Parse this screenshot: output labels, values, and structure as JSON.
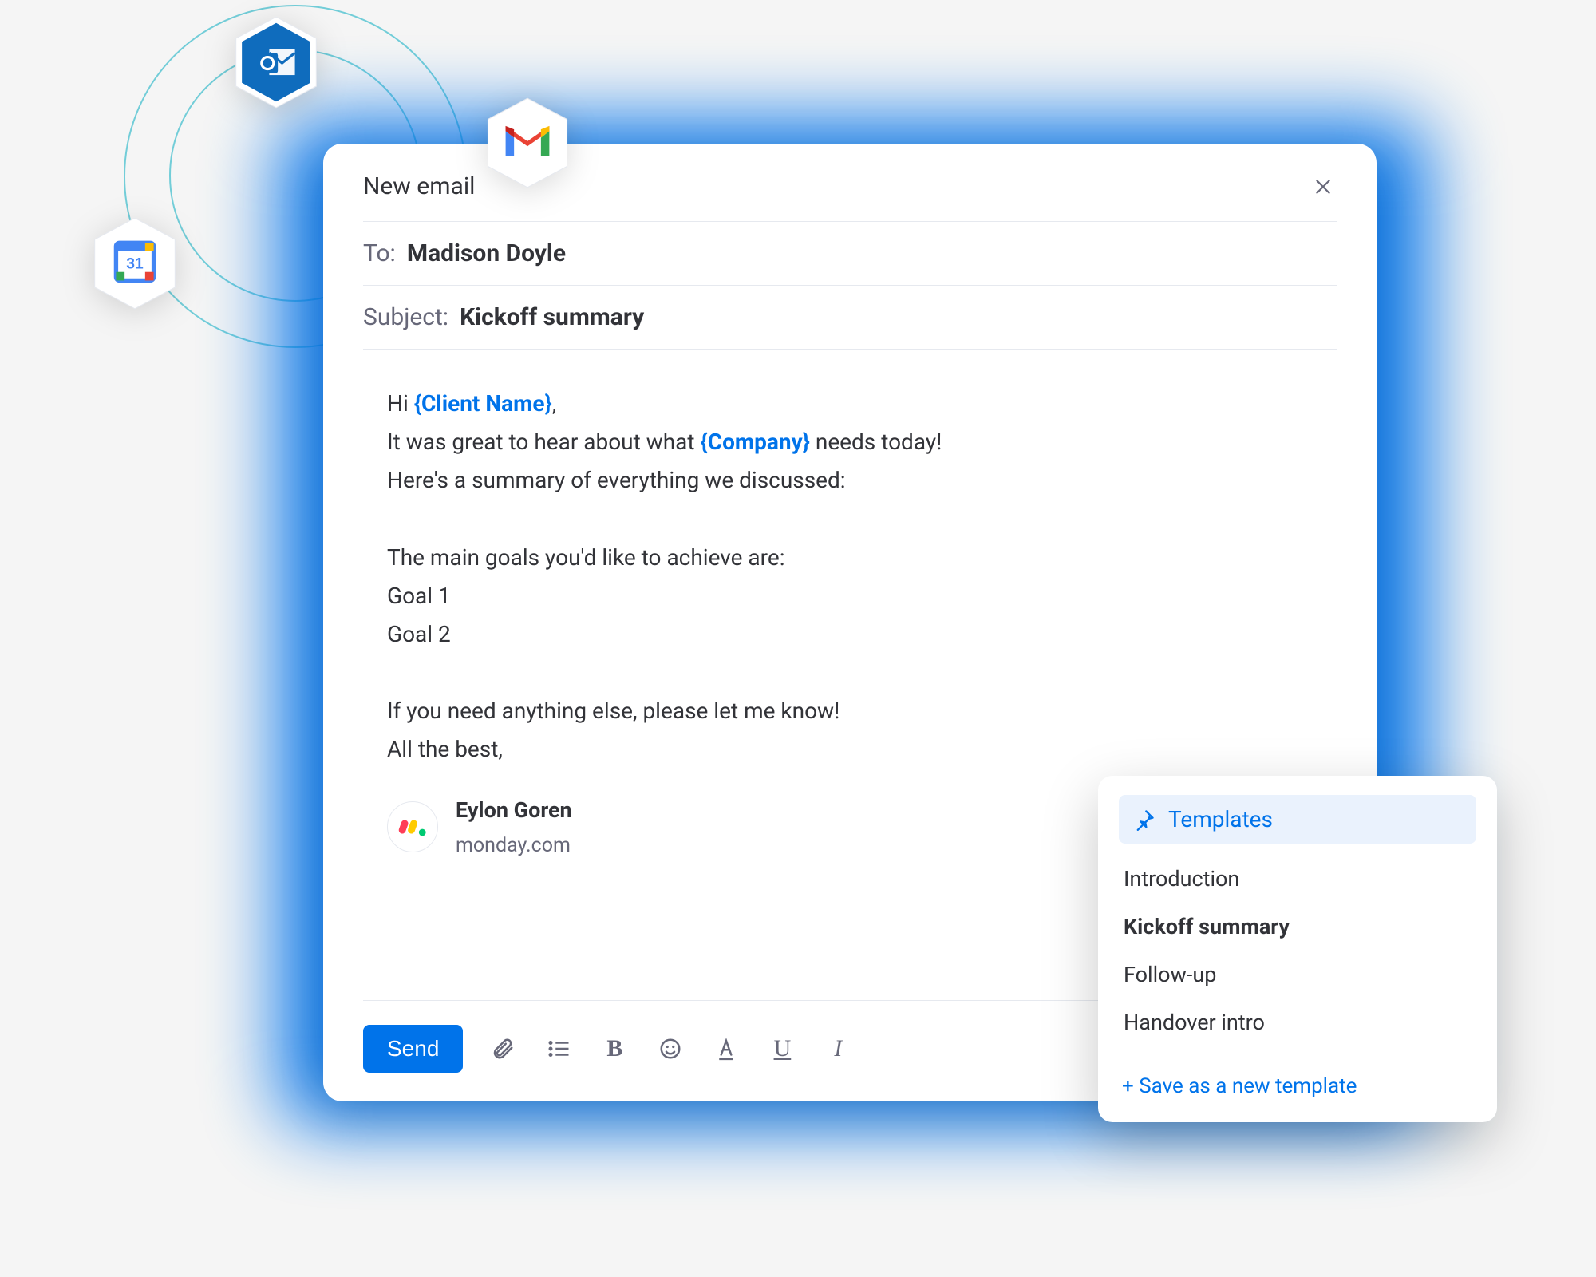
{
  "compose": {
    "title": "New email",
    "to_label": "To:",
    "to_value": "Madison Doyle",
    "subject_label": "Subject:",
    "subject_value": "Kickoff summary",
    "body": {
      "greeting_prefix": "Hi ",
      "token_client": "{Client Name}",
      "greeting_suffix": ",",
      "line2_prefix": "It was great to hear about what ",
      "token_company": "{Company}",
      "line2_suffix": " needs today!",
      "line3": "Here's a summary of everything we discussed:",
      "line4": "The main goals you'd like to achieve are:",
      "goal1": "Goal 1",
      "goal2": "Goal 2",
      "line7": "If you need anything else, please let me know!",
      "line8": "All the best,"
    },
    "signature": {
      "name": "Eylon Goren",
      "company": "monday.com"
    },
    "toolbar": {
      "send": "Send"
    }
  },
  "templates": {
    "header": "Templates",
    "items": [
      {
        "label": "Introduction",
        "selected": false
      },
      {
        "label": "Kickoff summary",
        "selected": true
      },
      {
        "label": "Follow-up",
        "selected": false
      },
      {
        "label": "Handover intro",
        "selected": false
      }
    ],
    "save": "+ Save as a new template"
  },
  "icons": {
    "outlook": "outlook-icon",
    "gcal": "google-calendar-icon",
    "gmail": "gmail-icon"
  }
}
